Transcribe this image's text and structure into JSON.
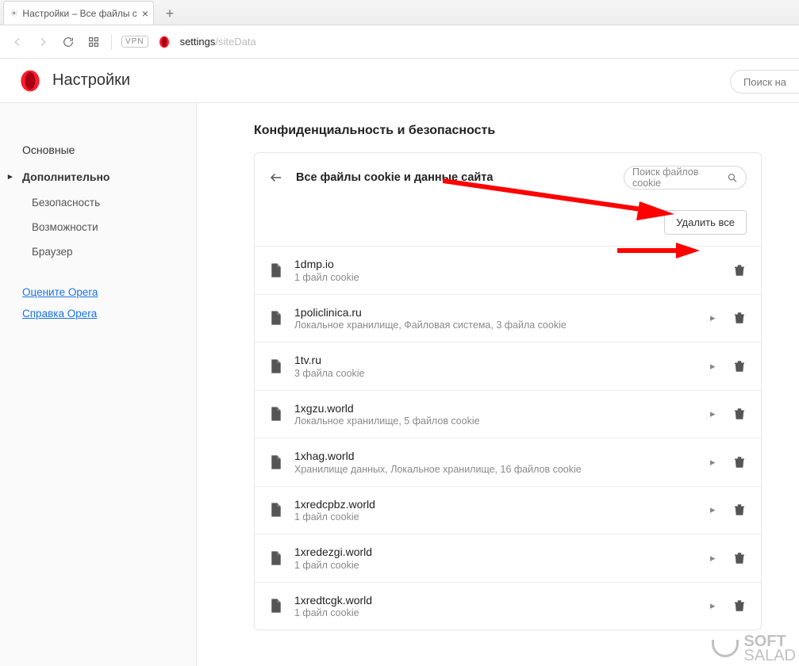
{
  "tab": {
    "title": "Настройки – Все файлы c"
  },
  "address": {
    "prefix": "settings",
    "suffix": "/siteData"
  },
  "header": {
    "title": "Настройки",
    "search_placeholder": "Поиск на"
  },
  "sidebar": {
    "items": [
      {
        "label": "Основные",
        "selected": false,
        "sub": false
      },
      {
        "label": "Дополнительно",
        "selected": true,
        "sub": false
      },
      {
        "label": "Безопасность",
        "selected": false,
        "sub": true
      },
      {
        "label": "Возможности",
        "selected": false,
        "sub": true
      },
      {
        "label": "Браузер",
        "selected": false,
        "sub": true
      }
    ],
    "links": [
      {
        "label": "Оцените Opera"
      },
      {
        "label": "Справка Opera"
      }
    ]
  },
  "section": {
    "title": "Конфиденциальность и безопасность"
  },
  "card": {
    "title": "Все файлы cookie и данные сайта",
    "search_placeholder": "Поиск файлов cookie",
    "delete_all_label": "Удалить все"
  },
  "sites": [
    {
      "name": "1dmp.io",
      "desc": "1 файл cookie",
      "expandable": false
    },
    {
      "name": "1policlinica.ru",
      "desc": "Локальное хранилище, Файловая система, 3 файла cookie",
      "expandable": true
    },
    {
      "name": "1tv.ru",
      "desc": "3 файла cookie",
      "expandable": true
    },
    {
      "name": "1xgzu.world",
      "desc": "Локальное хранилище, 5 файлов cookie",
      "expandable": true
    },
    {
      "name": "1xhag.world",
      "desc": "Хранилище данных, Локальное хранилище, 16 файлов cookie",
      "expandable": true
    },
    {
      "name": "1xredcpbz.world",
      "desc": "1 файл cookie",
      "expandable": true
    },
    {
      "name": "1xredezgi.world",
      "desc": "1 файл cookie",
      "expandable": true
    },
    {
      "name": "1xredtcgk.world",
      "desc": "1 файл cookie",
      "expandable": true
    }
  ],
  "watermark": {
    "line1": "SOFT",
    "line2": "SALAD"
  }
}
